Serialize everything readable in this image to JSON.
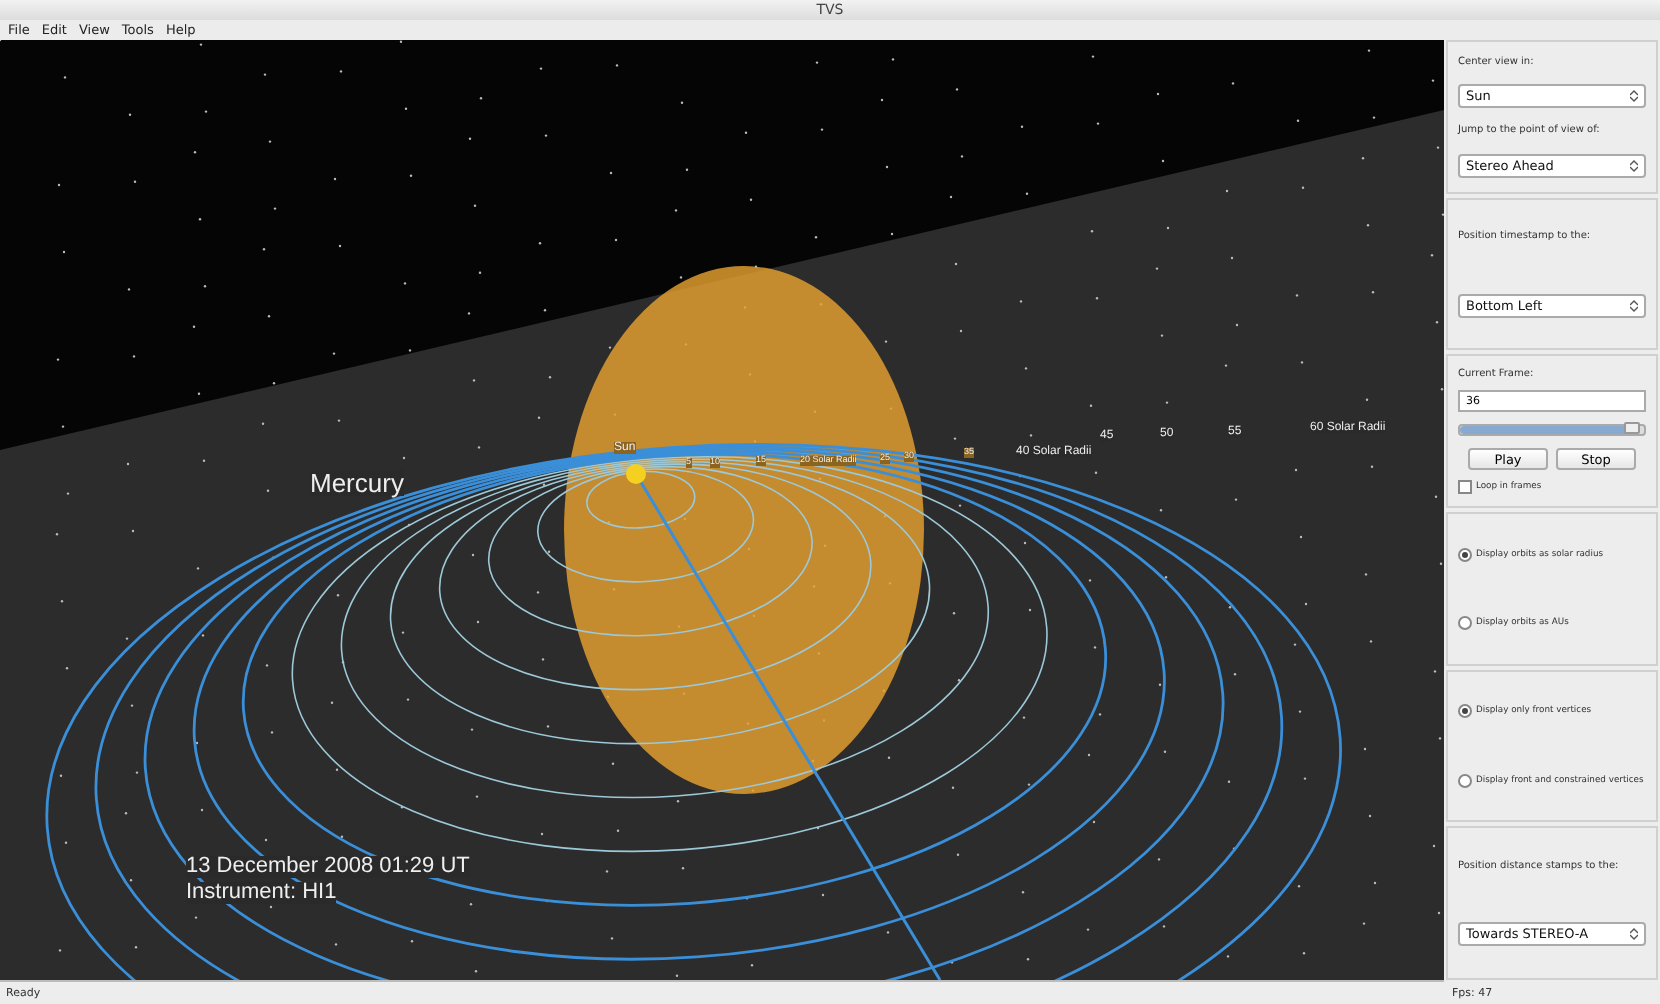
{
  "window": {
    "title": "TVS"
  },
  "menu": [
    "File",
    "Edit",
    "View",
    "Tools",
    "Help"
  ],
  "viewport": {
    "object_label": "Mercury",
    "sun_label": "Sun",
    "orbit_labels": [
      "5",
      "10",
      "15",
      "20 Solar Radii",
      "25",
      "30",
      "35",
      "40 Solar Radii",
      "45",
      "50",
      "55",
      "60 Solar Radii"
    ],
    "timestamp": "13 December 2008 01:29 UT",
    "instrument": "Instrument: HI1"
  },
  "panel": {
    "groups": [
      {
        "items": [
          {
            "kind": "label",
            "text": "Center view in:"
          },
          {
            "kind": "select",
            "value": "Sun"
          },
          {
            "kind": "label",
            "text": "Jump to the point of view of:"
          },
          {
            "kind": "select",
            "value": "Stereo Ahead"
          }
        ]
      },
      {
        "items": [
          {
            "kind": "label",
            "text": "Position timestamp to the:"
          },
          {
            "kind": "select",
            "value": "Bottom Left"
          }
        ]
      },
      {
        "items": [
          {
            "kind": "label",
            "text": "Current Frame:"
          },
          {
            "kind": "spin",
            "value": "36"
          },
          {
            "kind": "slider",
            "level": 0.97
          },
          {
            "kind": "buttons",
            "labels": [
              "Play",
              "Stop"
            ]
          },
          {
            "kind": "checkbox",
            "text": "Loop in frames",
            "checked": false
          }
        ]
      },
      {
        "items": [
          {
            "kind": "radio",
            "text": "Display orbits as solar radius",
            "selected": true
          },
          {
            "kind": "radio",
            "text": "Display orbits as AUs",
            "selected": false
          }
        ]
      },
      {
        "items": [
          {
            "kind": "radio",
            "text": "Display only front vertices",
            "selected": true
          },
          {
            "kind": "radio",
            "text": "Display front and constrained vertices",
            "selected": false
          }
        ]
      },
      {
        "items": [
          {
            "kind": "label",
            "text": "Position distance stamps to the:"
          },
          {
            "kind": "select",
            "value": "Towards STEREO-A"
          }
        ]
      }
    ],
    "fps": "Fps: 47"
  },
  "status_bar": "Ready"
}
